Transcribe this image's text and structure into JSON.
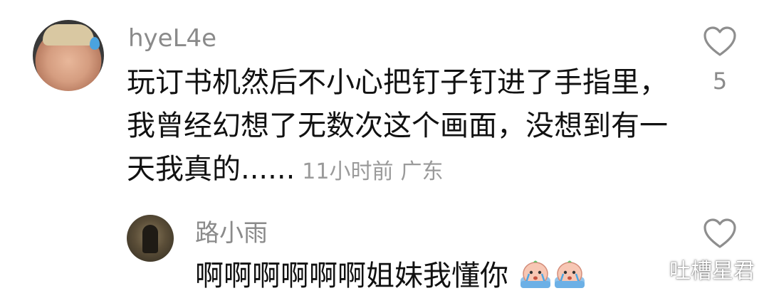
{
  "comment": {
    "username": "hyeL4e",
    "lines": [
      "玩订书机然后不小心把钉子钉进了手指里，",
      "我曾经幻想了无数次这个画面，没想到有一",
      "天我真的......"
    ],
    "time": "11小时前",
    "location": "广东",
    "like_count": "5"
  },
  "reply": {
    "username": "路小雨",
    "text": "啊啊啊啊啊啊姐妹我懂你"
  },
  "watermark": {
    "text": "吐槽星君"
  },
  "icons": {
    "like": "heart-outline-icon",
    "emoji": "crying-face-emoji",
    "watermark": "wechat-icon"
  }
}
